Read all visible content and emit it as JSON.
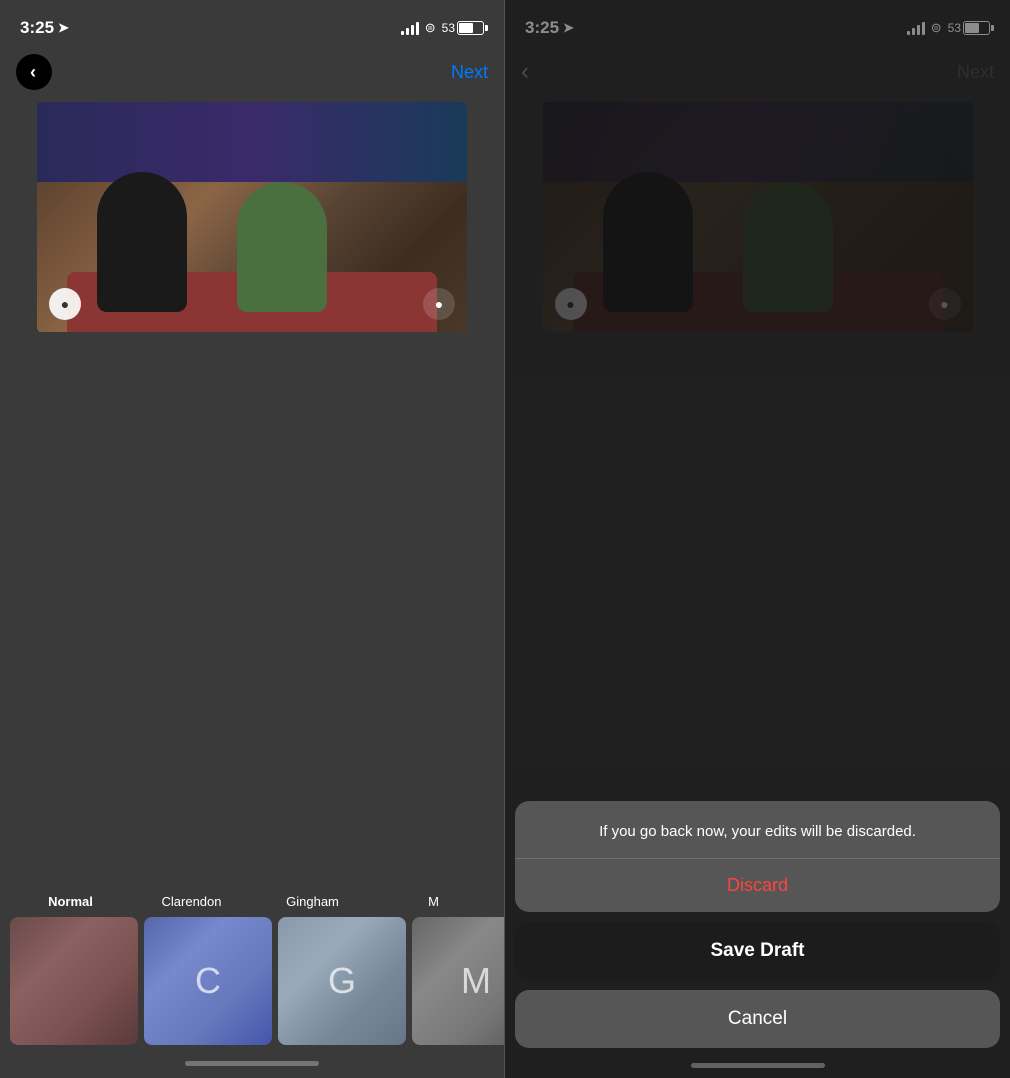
{
  "left_panel": {
    "status_bar": {
      "time": "3:25",
      "battery_level": "53"
    },
    "nav": {
      "next_label": "Next"
    },
    "filters": {
      "labels": [
        "Normal",
        "Clarendon",
        "Gingham",
        "M"
      ],
      "thumbnails": [
        {
          "name": "Normal",
          "letter": ""
        },
        {
          "name": "Clarendon",
          "letter": "C"
        },
        {
          "name": "Gingham",
          "letter": "G"
        },
        {
          "name": "M",
          "letter": "M"
        }
      ]
    }
  },
  "right_panel": {
    "status_bar": {
      "time": "3:25",
      "battery_level": "53"
    },
    "nav": {
      "next_label": "Next"
    },
    "action_sheet": {
      "message": "If you go back now, your edits will be discarded.",
      "discard_label": "Discard",
      "save_draft_label": "Save Draft",
      "cancel_label": "Cancel"
    }
  }
}
